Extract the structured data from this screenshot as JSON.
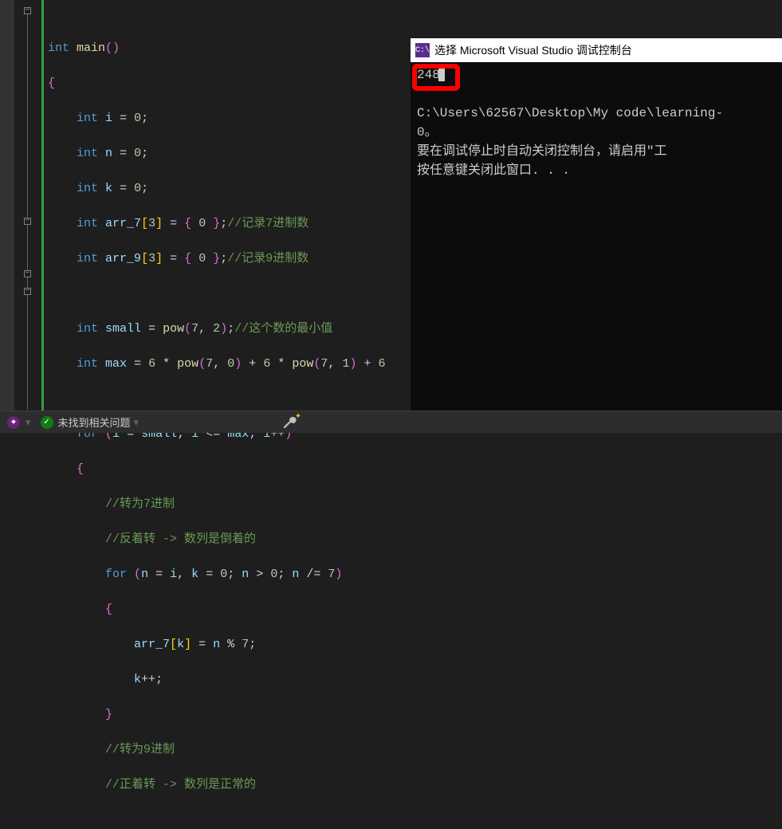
{
  "code": {
    "lines": [
      {
        "indent": 0,
        "raw": "int main()"
      },
      {
        "indent": 0,
        "raw": "{"
      },
      {
        "indent": 1,
        "raw": "int i = 0;"
      },
      {
        "indent": 1,
        "raw": "int n = 0;"
      },
      {
        "indent": 1,
        "raw": "int k = 0;"
      },
      {
        "indent": 1,
        "raw": "int arr_7[3] = { 0 };",
        "comment": "//记录7进制数"
      },
      {
        "indent": 1,
        "raw": "int arr_9[3] = { 0 };",
        "comment": "//记录9进制数"
      },
      {
        "indent": 1,
        "raw": ""
      },
      {
        "indent": 1,
        "raw": "int small = pow(7, 2);",
        "comment": "//这个数的最小值"
      },
      {
        "indent": 1,
        "raw": "int max = 6 * pow(7, 0) + 6 * pow(7, 1) + 6"
      },
      {
        "indent": 1,
        "raw": ""
      },
      {
        "indent": 1,
        "raw": "for (i = small; i <= max; i++)"
      },
      {
        "indent": 1,
        "raw": "{"
      },
      {
        "indent": 2,
        "comment": "//转为7进制"
      },
      {
        "indent": 2,
        "comment": "//反着转 -> 数列是倒着的"
      },
      {
        "indent": 2,
        "raw": "for (n = i, k = 0; n > 0; n /= 7)"
      },
      {
        "indent": 2,
        "raw": "{"
      },
      {
        "indent": 3,
        "raw": "arr_7[k] = n % 7;"
      },
      {
        "indent": 3,
        "raw": "k++;"
      },
      {
        "indent": 2,
        "raw": "}"
      },
      {
        "indent": 2,
        "comment": "//转为9进制"
      },
      {
        "indent": 2,
        "comment": "//正着转 -> 数列是正常的"
      }
    ]
  },
  "console": {
    "title": "选择 Microsoft Visual Studio 调试控制台",
    "output": "248",
    "path_line": "C:\\Users\\62567\\Desktop\\My code\\learning-",
    "exit_fragment": " 0。",
    "msg1": "要在调试停止时自动关闭控制台，请启用\"工",
    "msg2": "按任意键关闭此窗口. . ."
  },
  "status": {
    "text": "未找到相关问题"
  }
}
